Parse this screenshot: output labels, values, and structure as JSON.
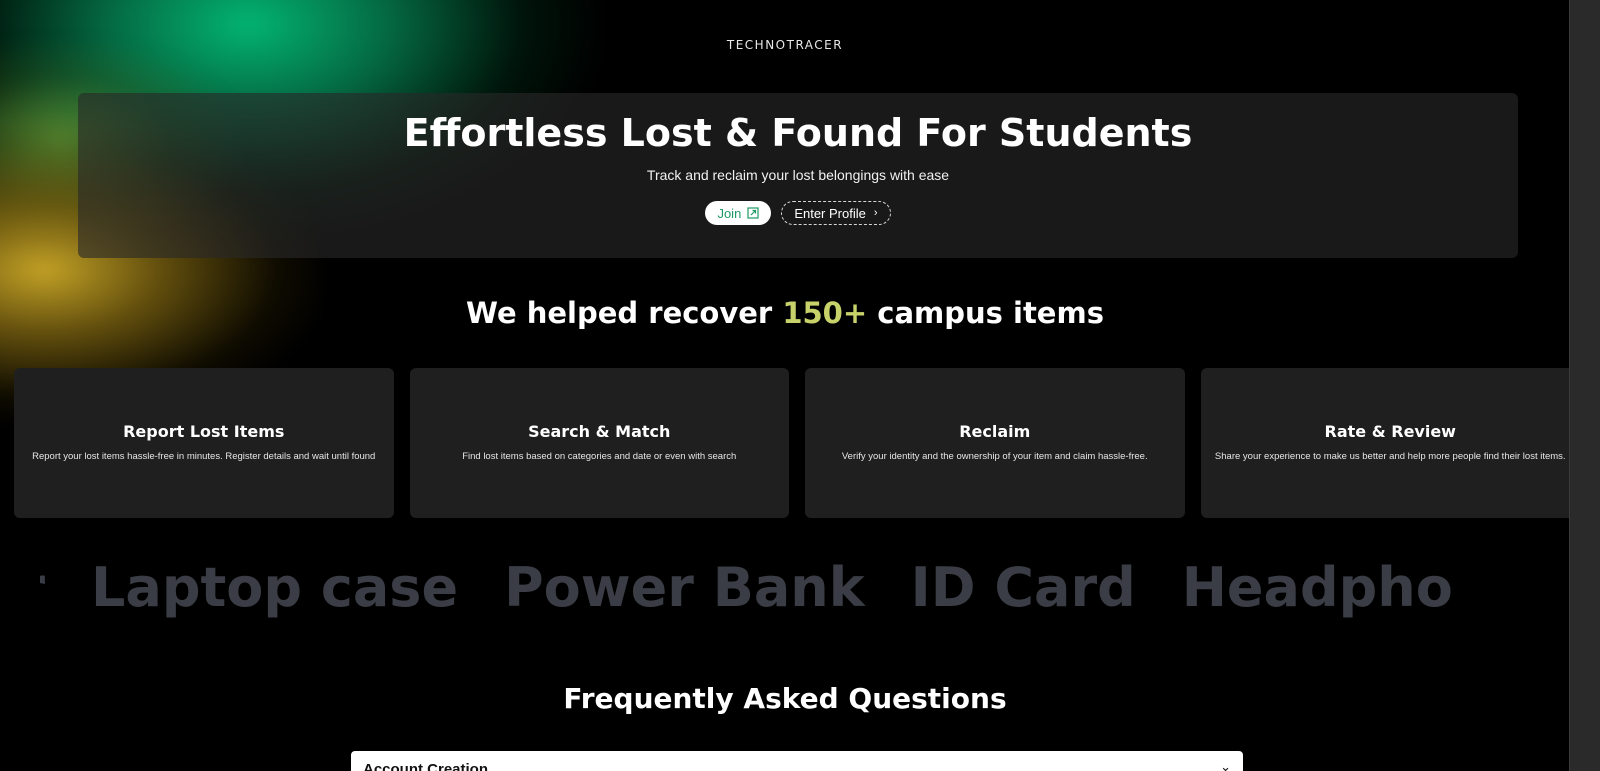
{
  "brand": "TECHNOTRACER",
  "hero": {
    "title": "Effortless Lost & Found For Students",
    "subtitle": "Track and reclaim your lost belongings with ease",
    "join_label": "Join",
    "profile_label": "Enter Profile"
  },
  "stats": {
    "prefix": "We helped recover ",
    "count": "150+",
    "suffix": " campus items"
  },
  "features": [
    {
      "title": "Report Lost Items",
      "desc": "Report your lost items hassle-free in minutes. Register details and wait until found"
    },
    {
      "title": "Search & Match",
      "desc": "Find lost items based on categories and date or even with search"
    },
    {
      "title": "Reclaim",
      "desc": "Verify your identity and the ownership of your item and claim hassle-free."
    },
    {
      "title": "Rate & Review",
      "desc": "Share your experience to make us better and help more people find their lost items."
    }
  ],
  "marquee": [
    "arger",
    "Laptop case",
    "Power Bank",
    "ID Card",
    "Headpho"
  ],
  "faq": {
    "title": "Frequently Asked Questions",
    "first_question": "Account Creation"
  },
  "colors": {
    "accent": "#c8d26a",
    "join_text": "#1d9a63",
    "glow_green": "#03be78",
    "glow_yellow": "#cdaa28"
  }
}
